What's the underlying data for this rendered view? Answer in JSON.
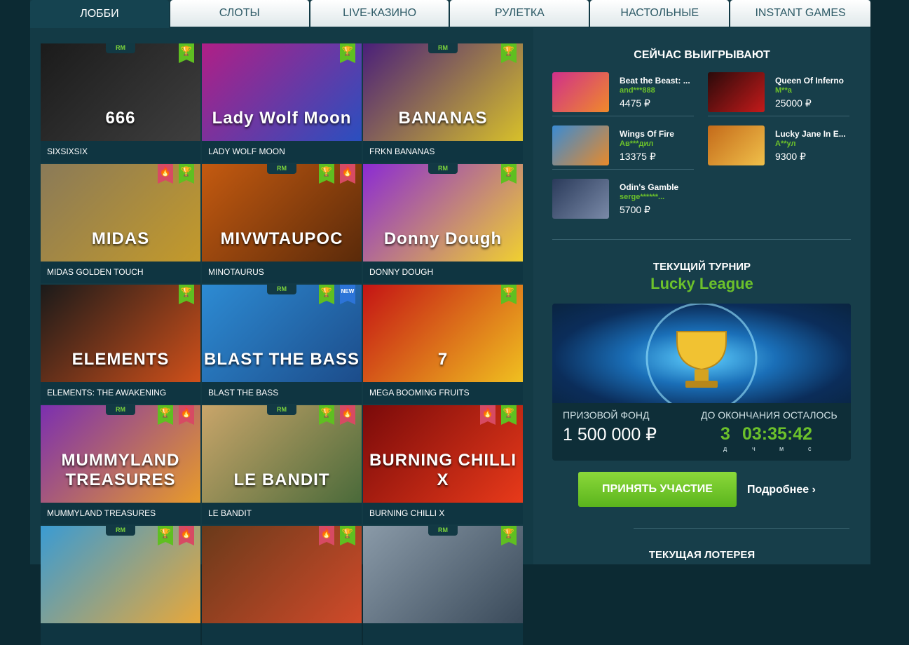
{
  "tabs": [
    {
      "label": "ЛОББИ",
      "active": true
    },
    {
      "label": "СЛОТЫ"
    },
    {
      "label": "LIVE-КАЗИНО"
    },
    {
      "label": "РУЛЕТКА"
    },
    {
      "label": "НАСТОЛЬНЫЕ"
    },
    {
      "label": "INSTANT GAMES"
    }
  ],
  "games": [
    {
      "name": "SIXSIXSIX",
      "logo": "666",
      "rm": true,
      "badges": [
        "trophy-icon"
      ],
      "colors": [
        "#1b1b1b",
        "#3f3f3f"
      ]
    },
    {
      "name": "LADY WOLF MOON",
      "logo": "Lady Wolf Moon",
      "badges": [
        "trophy-icon"
      ],
      "colors": [
        "#b01f86",
        "#2a4fbf"
      ]
    },
    {
      "name": "FRKN BANANAS",
      "logo": "BANANAS",
      "rm": true,
      "badges": [
        "trophy-icon"
      ],
      "colors": [
        "#4a1f7a",
        "#d7c02a"
      ]
    },
    {
      "name": "MIDAS GOLDEN TOUCH",
      "logo": "MIDAS",
      "badges": [
        "flame-icon",
        "trophy-icon"
      ],
      "colors": [
        "#8a7a58",
        "#c49a2a"
      ]
    },
    {
      "name": "MINOTAURUS",
      "logo": "MIVWTAUPOC",
      "rm": true,
      "badges": [
        "trophy-icon",
        "flame-icon"
      ],
      "colors": [
        "#c45a10",
        "#5a2a0a"
      ]
    },
    {
      "name": "DONNY DOUGH",
      "logo": "Donny Dough",
      "rm": true,
      "badges": [
        "trophy-icon"
      ],
      "colors": [
        "#8b2bd3",
        "#f0d030"
      ]
    },
    {
      "name": "ELEMENTS: THE AWAKENING",
      "logo": "ELEMENTS",
      "badges": [
        "trophy-icon"
      ],
      "colors": [
        "#1a1a1a",
        "#d0501a"
      ]
    },
    {
      "name": "BLAST THE BASS",
      "logo": "BLAST THE BASS",
      "rm": true,
      "badges": [
        "trophy-icon",
        "new-badge"
      ],
      "colors": [
        "#2d8bd3",
        "#1c4c8a"
      ]
    },
    {
      "name": "MEGA BOOMING FRUITS",
      "logo": "7",
      "badges": [
        "trophy-icon"
      ],
      "colors": [
        "#c41414",
        "#f0c020"
      ]
    },
    {
      "name": "MUMMYLAND TREASURES",
      "logo": "MUMMYLAND TREASURES",
      "rm": true,
      "badges": [
        "trophy-icon",
        "flame-icon"
      ],
      "colors": [
        "#7b2fb0",
        "#e89b2a"
      ]
    },
    {
      "name": "LE BANDIT",
      "logo": "LE BANDIT",
      "rm": true,
      "badges": [
        "trophy-icon",
        "flame-icon"
      ],
      "colors": [
        "#c9a56a",
        "#4a6a3a"
      ]
    },
    {
      "name": "BURNING CHILLI X",
      "logo": "BURNING CHILLI X",
      "badges": [
        "flame-icon",
        "trophy-icon"
      ],
      "colors": [
        "#7a0a0a",
        "#e83a1a"
      ]
    },
    {
      "name": "",
      "logo": "",
      "rm": true,
      "badges": [
        "trophy-icon",
        "flame-icon"
      ],
      "colors": [
        "#3a9bd3",
        "#e8a83a"
      ]
    },
    {
      "name": "",
      "logo": "",
      "badges": [
        "flame-icon",
        "trophy-icon"
      ],
      "colors": [
        "#6a3a1a",
        "#d04a2a"
      ]
    },
    {
      "name": "",
      "logo": "",
      "rm": true,
      "badges": [
        "trophy-icon"
      ],
      "colors": [
        "#8a9aa8",
        "#3a4a5a"
      ]
    }
  ],
  "rm_label": "RM",
  "new_label": "NEW",
  "winners": {
    "title": "СЕЙЧАС ВЫИГРЫВАЮТ",
    "items": [
      {
        "game": "Beat the Beast: ...",
        "user": "and***888",
        "amount": "4475 ₽",
        "colors": [
          "#d0308a",
          "#f08a2a"
        ]
      },
      {
        "game": "Queen Of Inferno",
        "user": "M**a",
        "amount": "25000 ₽",
        "colors": [
          "#2a0a0a",
          "#c41a1a"
        ]
      },
      {
        "game": "Wings Of Fire",
        "user": "Ав***дил",
        "amount": "13375 ₽",
        "colors": [
          "#3a8bd3",
          "#e88a2a"
        ]
      },
      {
        "game": "Lucky Jane In E...",
        "user": "А**ул",
        "amount": "9300 ₽",
        "colors": [
          "#c46a1a",
          "#f0c04a"
        ]
      },
      {
        "game": "Odin's Gamble",
        "user": "serge******...",
        "amount": "5700 ₽",
        "colors": [
          "#2a3a5a",
          "#7a8aa8"
        ]
      }
    ]
  },
  "tournament": {
    "title": "ТЕКУЩИЙ ТУРНИР",
    "name": "Lucky League",
    "prize_label": "ПРИЗОВОЙ ФОНД",
    "prize": "1 500 000 ₽",
    "ends_label": "ДО ОКОНЧАНИЯ ОСТАЛОСЬ",
    "days": "3",
    "time": "03:35:42",
    "units": [
      "д",
      "ч",
      "м",
      "с"
    ],
    "join": "ПРИНЯТЬ УЧАСТИЕ",
    "more": "Подробнее"
  },
  "lottery": {
    "title": "ТЕКУЩАЯ ЛОТЕРЕЯ"
  },
  "colors": {
    "accent": "#6cc12b",
    "panel": "#173e4a",
    "hot": "#d74a63",
    "new": "#2c74d8"
  }
}
